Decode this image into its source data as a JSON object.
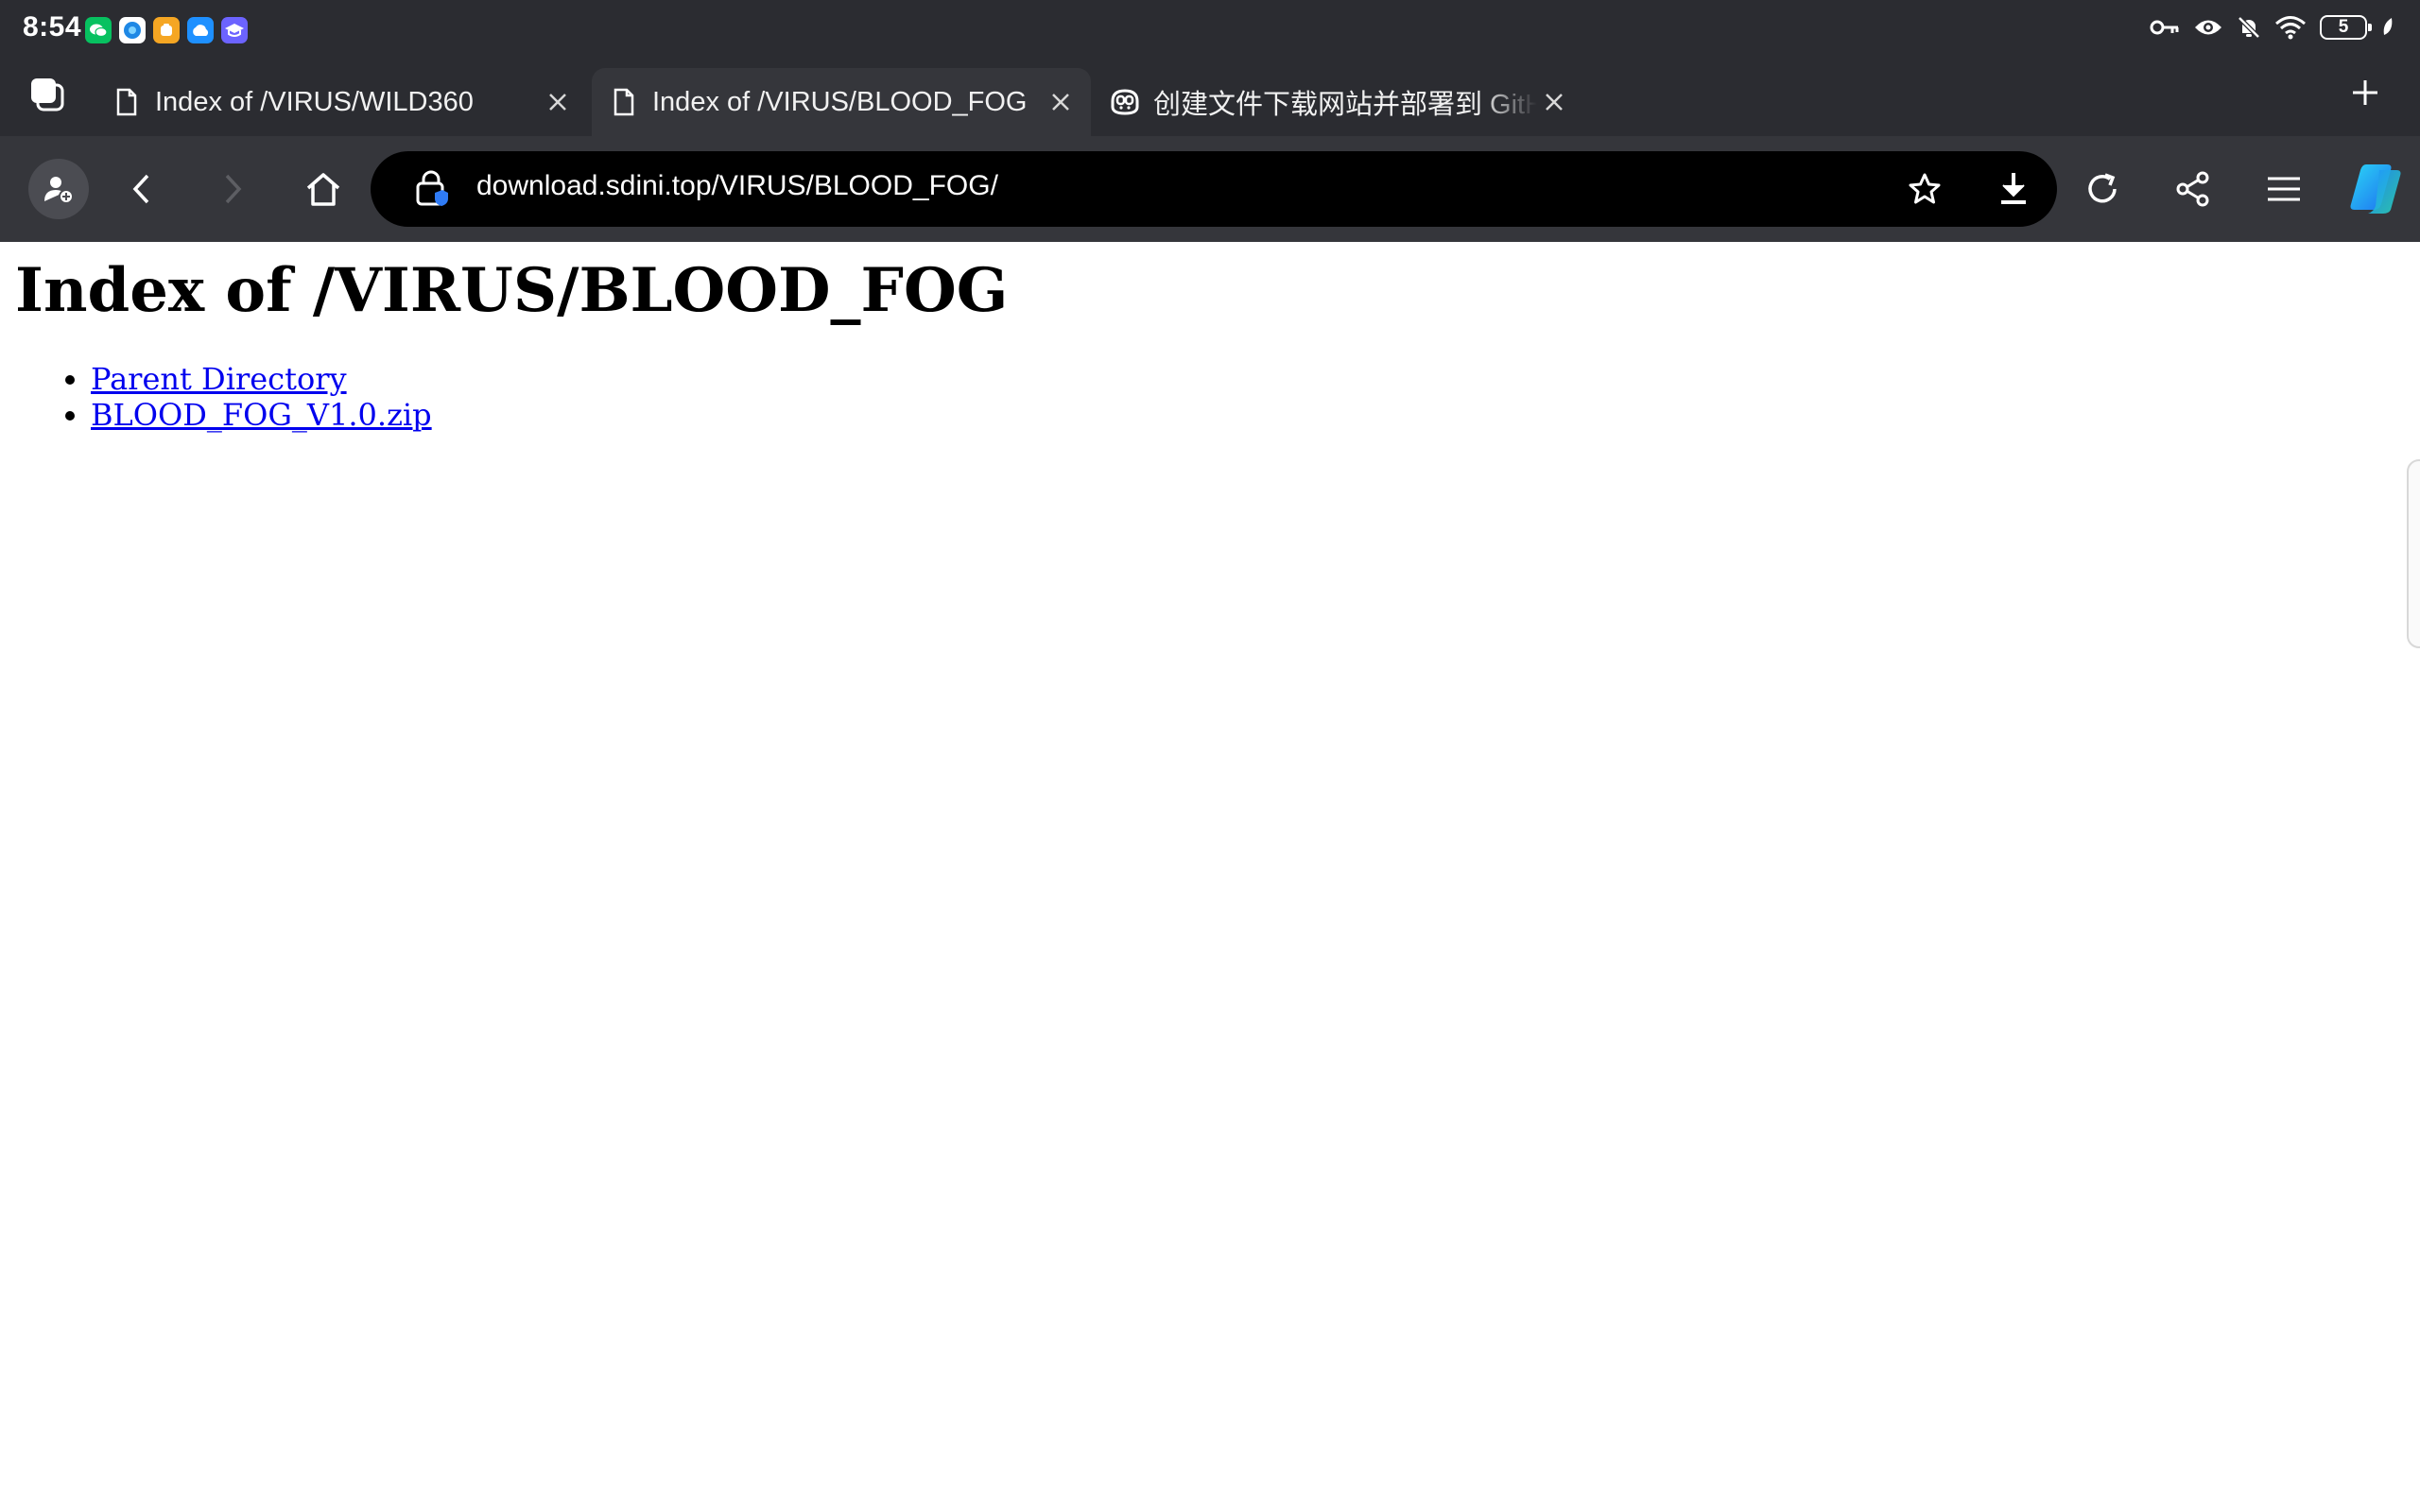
{
  "status_bar": {
    "time": "8:54",
    "notification_icons": [
      {
        "name": "wechat-icon",
        "color": "#07c160"
      },
      {
        "name": "browser-app-icon",
        "color": "#1e88e5"
      },
      {
        "name": "notes-app-icon",
        "color": "#f5a623"
      },
      {
        "name": "cloud-app-icon",
        "color": "#1e90ff"
      },
      {
        "name": "education-app-icon",
        "color": "#6c63ff"
      }
    ],
    "battery_level": "5"
  },
  "tabs": [
    {
      "title": "Index of /VIRUS/WILD360",
      "icon": "page-icon",
      "active": false
    },
    {
      "title": "Index of /VIRUS/BLOOD_FOG",
      "icon": "page-icon",
      "active": true
    },
    {
      "title": "创建文件下载网站并部署到 GitHub",
      "icon": "copilot-icon",
      "active": false
    }
  ],
  "address_bar": {
    "url": "download.sdini.top/VIRUS/BLOOD_FOG/"
  },
  "page": {
    "heading": "Index of /VIRUS/BLOOD_FOG",
    "links": [
      "Parent Directory",
      "BLOOD_FOG_V1.0.zip"
    ]
  },
  "colors": {
    "chrome_background": "#2b2c31",
    "toolbar_background": "#35363b",
    "omnibox_background": "#000000",
    "link": "#0000ee"
  }
}
